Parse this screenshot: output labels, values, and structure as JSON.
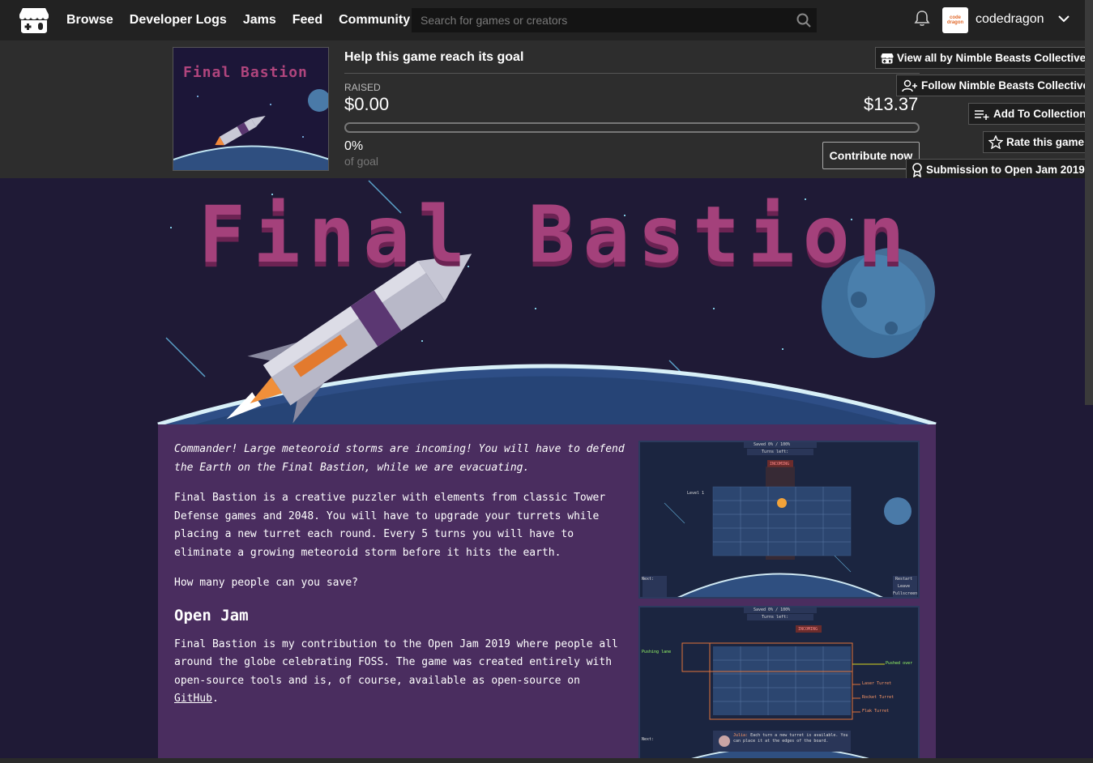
{
  "nav": {
    "links": [
      "Browse",
      "Developer Logs",
      "Jams",
      "Feed",
      "Community"
    ],
    "search_placeholder": "Search for games or creators",
    "avatar_text": "code dragon",
    "username": "codedragon"
  },
  "donate": {
    "thumb_title": "Final Bastion",
    "title": "Help this game reach its goal",
    "raised_label": "RAISED",
    "raised_value": "$0.00",
    "goal_value": "$13.37",
    "progress_fraction": 0,
    "percent": "0%",
    "of_goal": "of goal",
    "contribute_label": "Contribute now"
  },
  "side_buttons": {
    "view_all": "View all by Nimble Beasts Collective",
    "follow": "Follow Nimble Beasts Collective",
    "add_collection": "Add To Collection",
    "rate": "Rate this game",
    "submission": "Submission to Open Jam 2019"
  },
  "banner": {
    "title": "Final Bastion"
  },
  "description": {
    "intro": "Commander! Large meteoroid storms are incoming! You will have to defend the Earth on the Final Bastion, while we are evacuating.",
    "para1": "Final Bastion is a creative puzzler with elements from classic Tower Defense games and 2048. You will have to upgrade your turrets while placing a new turret each round. Every 5 turns you will have to eliminate a growing meteoroid storm before it hits the earth.",
    "para2": "How many people can you save?",
    "heading": "Open Jam",
    "para3_prefix": "Final Bastion is my contribution to the Open Jam 2019 where people all around the globe celebrating FOSS. The game was created entirely with open-source tools and is, of course, available as open-source on ",
    "para3_link": "GitHub",
    "para3_suffix": "."
  },
  "screenshot1": {
    "saved": "Saved 0% / 100%",
    "turns": "Turns left:",
    "incoming": "INCOMING",
    "level": "Level 1",
    "next": "Next:",
    "restart": "Restart",
    "leave": "Leave",
    "fullscreen": "Fullscreen"
  },
  "screenshot2": {
    "saved": "Saved 0% / 100%",
    "turns": "Turns left:",
    "incoming": "INCOMING",
    "pushing_lane": "Pushing lane",
    "pushed_over": "Pushed over",
    "laser": "Laser Turret",
    "rocket": "Rocket Turret",
    "flak": "Flak Turret",
    "next": "Next:",
    "tip_name": "Julia:",
    "tip_text": "Each turn a new turret is available. You can place it at the edges of the board."
  },
  "colors": {
    "nav_bg": "#222222",
    "donate_bg": "#2d2d2d",
    "page_bg": "#1f1a36",
    "content_bg": "#4a2d5f",
    "title_pink": "#a4417b"
  }
}
